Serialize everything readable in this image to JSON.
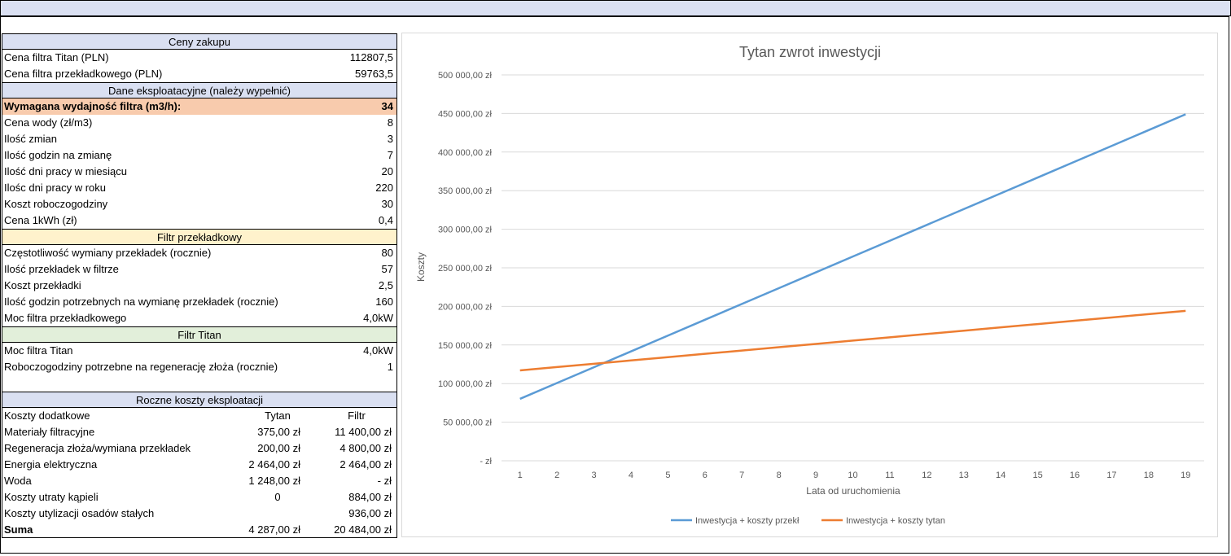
{
  "sheet": {
    "purchase": {
      "header": "Ceny zakupu",
      "rows": [
        {
          "label": "Cena filtra Titan (PLN)",
          "value": "112807,5"
        },
        {
          "label": "Cena filtra przekładkowego (PLN)",
          "value": "59763,5"
        }
      ]
    },
    "operating": {
      "header": "Dane eksploatacyjne (należy wypełnić)",
      "highlight": {
        "label": "Wymagana wydajność filtra (m3/h):",
        "value": "34"
      },
      "rows": [
        {
          "label": "Cena wody (zł/m3)",
          "value": "8"
        },
        {
          "label": "Ilość zmian",
          "value": "3"
        },
        {
          "label": "Ilość godzin na zmianę",
          "value": "7"
        },
        {
          "label": "Ilość dni pracy w miesiącu",
          "value": "20"
        },
        {
          "label": "Ilośc dni pracy w roku",
          "value": "220"
        },
        {
          "label": "Koszt roboczogodziny",
          "value": "30"
        },
        {
          "label": "Cena 1kWh (zł)",
          "value": "0,4"
        }
      ]
    },
    "plate_filter": {
      "header": "Filtr przekładkowy",
      "rows": [
        {
          "label": "Częstotliwość wymiany przekładek (rocznie)",
          "value": "80"
        },
        {
          "label": "Ilość przekładek w filtrze",
          "value": "57"
        },
        {
          "label": "Koszt przekładki",
          "value": "2,5"
        },
        {
          "label": "Ilość godzin potrzebnych na wymianę przekładek (rocznie)",
          "value": "160"
        },
        {
          "label": "Moc filtra przekładkowego",
          "value": "4,0kW"
        }
      ]
    },
    "titan_filter": {
      "header": "Filtr Titan",
      "rows": [
        {
          "label": "Moc filtra Titan",
          "value": "4,0kW"
        },
        {
          "label": "Roboczogodziny potrzebne na regenerację złoża (rocznie)",
          "value": "1"
        }
      ]
    },
    "annual_costs": {
      "header": "Roczne koszty eksploatacji",
      "col_header": {
        "label": "Koszty dodatkowe",
        "tytan": "Tytan",
        "filtr": "Filtr"
      },
      "rows": [
        {
          "label": "Materiały filtracyjne",
          "tytan": "375,00 zł",
          "filtr": "11 400,00 zł"
        },
        {
          "label": "Regeneracja złoża/wymiana przekładek",
          "tytan": "200,00 zł",
          "filtr": "4 800,00 zł"
        },
        {
          "label": "Energia elektryczna",
          "tytan": "2 464,00 zł",
          "filtr": "2 464,00 zł"
        },
        {
          "label": "Woda",
          "tytan": "1 248,00 zł",
          "filtr": "-    zł"
        },
        {
          "label": "Koszty utraty kąpieli",
          "tytan": "0",
          "filtr": "884,00 zł"
        },
        {
          "label": "Koszty utylizacji osadów stałych",
          "tytan": "",
          "filtr": "936,00 zł"
        }
      ],
      "sum": {
        "label": "Suma",
        "tytan": "4 287,00 zł",
        "filtr": "20 484,00 zł"
      }
    }
  },
  "chart_data": {
    "type": "line",
    "title": "Tytan zwrot inwestycji",
    "xlabel": "Lata od uruchomienia",
    "ylabel": "Koszty",
    "categories": [
      1,
      2,
      3,
      4,
      5,
      6,
      7,
      8,
      9,
      10,
      11,
      12,
      13,
      14,
      15,
      16,
      17,
      18,
      19
    ],
    "ylim": [
      0,
      500000
    ],
    "yticks": [
      0,
      50000,
      100000,
      150000,
      200000,
      250000,
      300000,
      350000,
      400000,
      450000,
      500000
    ],
    "ytick_labels": [
      "-  zł",
      "50 000,00 zł",
      "100 000,00 zł",
      "150 000,00 zł",
      "200 000,00 zł",
      "250 000,00 zł",
      "300 000,00 zł",
      "350 000,00 zł",
      "400 000,00 zł",
      "450 000,00 zł",
      "500 000,00 zł"
    ],
    "grid": true,
    "legend_position": "bottom",
    "series": [
      {
        "name": "Inwestycja + koszty przekł",
        "color": "#5b9bd5",
        "values": [
          80248,
          100732,
          121216,
          141700,
          162184,
          182668,
          203152,
          223636,
          244120,
          264604,
          285088,
          305572,
          326056,
          346540,
          367024,
          387508,
          407992,
          428476,
          448960
        ]
      },
      {
        "name": "Inwestycja + koszty tytan",
        "color": "#ed7d31",
        "values": [
          117095,
          121382,
          125669,
          129956,
          134243,
          138530,
          142817,
          147104,
          151391,
          155678,
          159965,
          164252,
          168539,
          172826,
          177113,
          181400,
          185687,
          189974,
          194261
        ]
      }
    ]
  }
}
